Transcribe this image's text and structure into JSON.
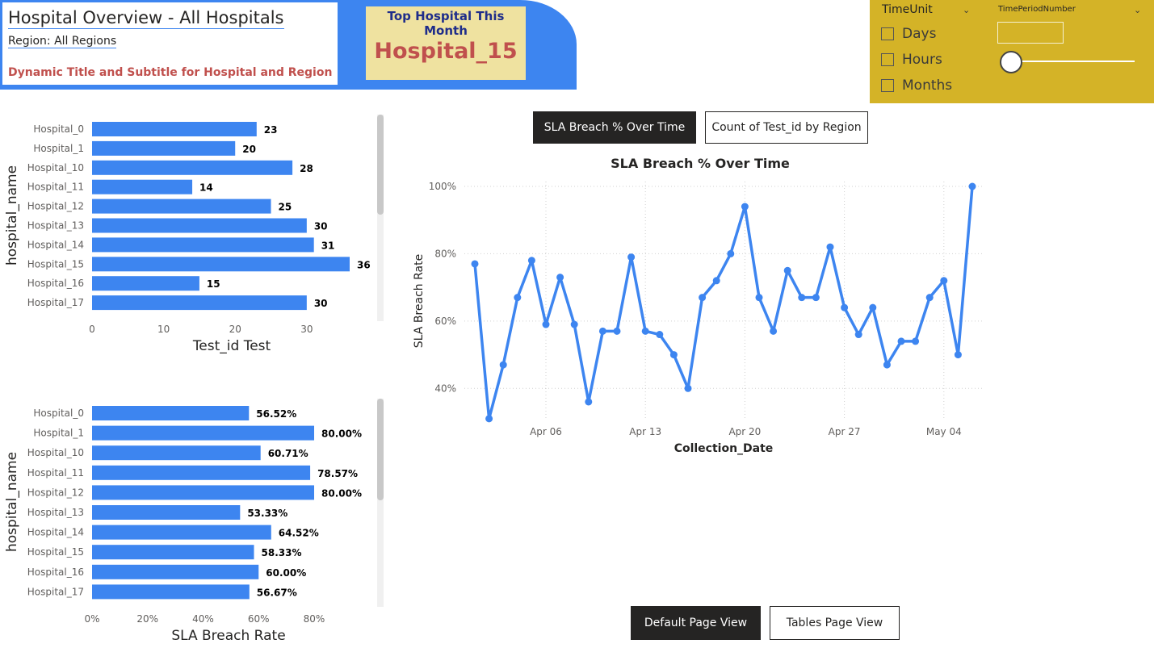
{
  "header": {
    "title": "Hospital Overview - All Hospitals",
    "region": "Region: All Regions",
    "note": "Dynamic Title and Subtitle for Hospital and Region",
    "top_card_title": "Top Hospital This Month",
    "top_card_value": "Hospital_15"
  },
  "slicers": {
    "time_unit_label": "TimeUnit",
    "time_period_label": "TimePeriodNumber",
    "options": [
      "Days",
      "Hours",
      "Months"
    ],
    "slider_value_fraction": 0
  },
  "tabs": {
    "sla_breach": "SLA Breach % Over Time",
    "count_by_region": "Count of Test_id by Region"
  },
  "nav": {
    "default_view": "Default Page View",
    "tables_view": "Tables Page View"
  },
  "colors": {
    "accent": "#3d85f0",
    "slicer_bg": "#d4b327",
    "title_red": "#c0504d",
    "card_bg": "#efe2a0"
  },
  "chart_data": [
    {
      "type": "bar",
      "orientation": "horizontal",
      "ylabel": "hospital_name",
      "xlabel": "Test_id Test",
      "categories": [
        "Hospital_0",
        "Hospital_1",
        "Hospital_10",
        "Hospital_11",
        "Hospital_12",
        "Hospital_13",
        "Hospital_14",
        "Hospital_15",
        "Hospital_16",
        "Hospital_17"
      ],
      "values": [
        23,
        20,
        28,
        14,
        25,
        30,
        31,
        36,
        15,
        30
      ],
      "data_labels": [
        "23",
        "20",
        "28",
        "14",
        "25",
        "30",
        "31",
        "36",
        "15",
        "30"
      ],
      "xticks": [
        "0",
        "10",
        "20",
        "30"
      ],
      "xlim": [
        0,
        36
      ]
    },
    {
      "type": "bar",
      "orientation": "horizontal",
      "ylabel": "hospital_name",
      "xlabel": "SLA Breach Rate",
      "categories": [
        "Hospital_0",
        "Hospital_1",
        "Hospital_10",
        "Hospital_11",
        "Hospital_12",
        "Hospital_13",
        "Hospital_14",
        "Hospital_15",
        "Hospital_16",
        "Hospital_17"
      ],
      "values": [
        56.52,
        80.0,
        60.71,
        78.57,
        80.0,
        53.33,
        64.52,
        58.33,
        60.0,
        56.67
      ],
      "data_labels": [
        "56.52%",
        "80.00%",
        "60.71%",
        "78.57%",
        "80.00%",
        "53.33%",
        "64.52%",
        "58.33%",
        "60.00%",
        "56.67%"
      ],
      "xticks": [
        "0%",
        "20%",
        "40%",
        "60%",
        "80%"
      ],
      "xlim": [
        0,
        80
      ]
    },
    {
      "type": "line",
      "title": "SLA Breach % Over Time",
      "xlabel": "Collection_Date",
      "ylabel": "SLA Breach Rate",
      "x": [
        "Apr 01",
        "Apr 02",
        "Apr 03",
        "Apr 04",
        "Apr 05",
        "Apr 06",
        "Apr 07",
        "Apr 08",
        "Apr 09",
        "Apr 10",
        "Apr 11",
        "Apr 12",
        "Apr 13",
        "Apr 14",
        "Apr 15",
        "Apr 16",
        "Apr 17",
        "Apr 18",
        "Apr 19",
        "Apr 20",
        "Apr 21",
        "Apr 22",
        "Apr 23",
        "Apr 24",
        "Apr 25",
        "Apr 26",
        "Apr 27",
        "Apr 28",
        "Apr 29",
        "Apr 30",
        "May 01",
        "May 02",
        "May 03",
        "May 04",
        "May 05",
        "May 06"
      ],
      "y": [
        77,
        31,
        47,
        67,
        78,
        59,
        73,
        59,
        36,
        57,
        57,
        79,
        57,
        56,
        50,
        40,
        67,
        72,
        80,
        94,
        67,
        57,
        75,
        67,
        67,
        82,
        64,
        56,
        64,
        47,
        54,
        54,
        67,
        72,
        50,
        100
      ],
      "xticks": [
        "Apr 06",
        "Apr 13",
        "Apr 20",
        "Apr 27",
        "May 04"
      ],
      "yticks": [
        "40%",
        "60%",
        "80%",
        "100%"
      ],
      "ylim": [
        30,
        100
      ],
      "grid": true
    }
  ]
}
